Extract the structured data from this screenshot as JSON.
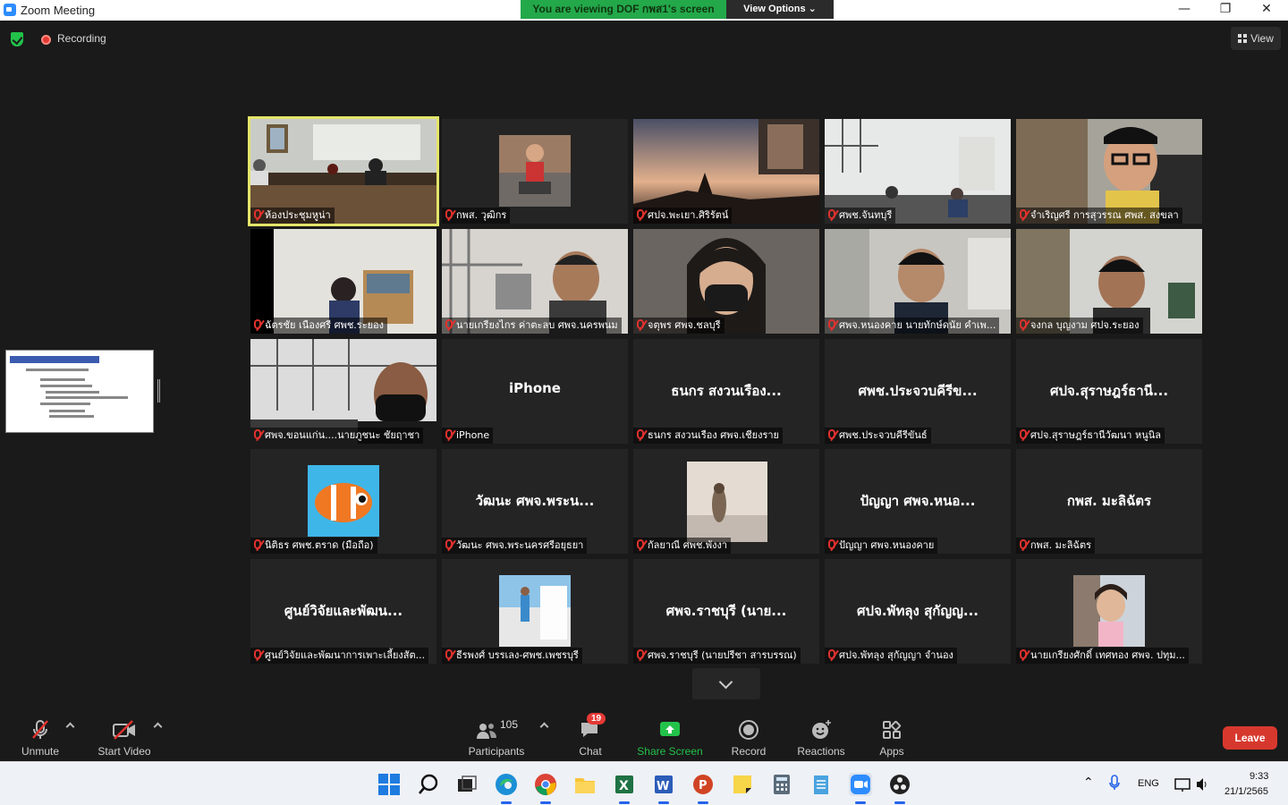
{
  "window": {
    "title": "Zoom Meeting",
    "minimize": "—",
    "restore": "❐",
    "close": "✕"
  },
  "share_banner": {
    "text": "You are viewing DOF กพส1's screen",
    "view_options": "View Options ⌄"
  },
  "topbar": {
    "recording_label": "Recording",
    "view_label": "View"
  },
  "tiles": [
    {
      "name": "ห้องประชุมหูน่า",
      "kind": "video",
      "active": true,
      "scene": "conference"
    },
    {
      "name": "กพส. วุฒิกร",
      "kind": "avatar",
      "scene": "person-red"
    },
    {
      "name": "ศปจ.พะเยา.ศิริรัตน์",
      "kind": "video",
      "scene": "sunset"
    },
    {
      "name": "ศพช.จันทบุรี",
      "kind": "video",
      "scene": "office"
    },
    {
      "name": "จำเริญศรี การสุวรรณ ศพส. สงขลา",
      "kind": "video",
      "scene": "man-glasses"
    },
    {
      "name": "ฉัตรชัย เนืองศรี ศพช.ระยอง",
      "kind": "video",
      "scene": "shelf"
    },
    {
      "name": "นายเกรียงไกร ค่าตะลบ ศพจ.นครพนม",
      "kind": "video",
      "scene": "pipes"
    },
    {
      "name": "จตุพร ศพจ.ชลบุรี",
      "kind": "video",
      "scene": "woman-mask"
    },
    {
      "name": "ศพจ.หนองคาย นายทักษ์ดนัย คำเพ...",
      "kind": "video",
      "scene": "man-office"
    },
    {
      "name": "จงกล บุญงาม ศปจ.ระยอง",
      "kind": "video",
      "scene": "man-office2"
    },
    {
      "name": "ศพจ.ขอนแก่น....นายภูชนะ ชัยฤาชา",
      "kind": "video",
      "scene": "man-mask"
    },
    {
      "name": "iPhone",
      "kind": "text",
      "big": "iPhone"
    },
    {
      "name": "ธนกร สงวนเรือง ศพจ.เชียงราย",
      "kind": "text",
      "big": "ธนกร สงวนเรือง..."
    },
    {
      "name": "ศพช.ประจวบคีรีขันธ์",
      "kind": "text",
      "big": "ศพช.ประจวบคีรีข..."
    },
    {
      "name": "ศปจ.สุราษฎร์ธานีวัฒนา หนูนิล",
      "kind": "text",
      "big": "ศปจ.สุราษฎร์ธานี..."
    },
    {
      "name": "นิติธร ศพช.ตราด (มือถือ)",
      "kind": "avatar",
      "scene": "fish"
    },
    {
      "name": "วัฒนะ ศพจ.พระนครศรีอยุธยา",
      "kind": "text",
      "big": "วัฒนะ ศพจ.พระน..."
    },
    {
      "name": "กัลยาณี ศพช.พังงา",
      "kind": "avatar",
      "scene": "beach"
    },
    {
      "name": "ปัญญา ศพจ.หนองคาย",
      "kind": "text",
      "big": "ปัญญา ศพจ.หนอ..."
    },
    {
      "name": "กพส. มะลิฉัตร",
      "kind": "text",
      "big": "กพส. มะลิฉัตร"
    },
    {
      "name": "ศูนย์วิจัยและพัฒนาการเพาะเลี้ยงสัต...",
      "kind": "text",
      "big": "ศูนย์วิจัยและพัฒน..."
    },
    {
      "name": "ธีรพงศ์ บรรเลง-ศพช.เพชรบุรี",
      "kind": "avatar",
      "scene": "pool"
    },
    {
      "name": "ศพจ.ราชบุรี (นายปรีชา สารบรรณ)",
      "kind": "text",
      "big": "ศพจ.ราชบุรี (นาย..."
    },
    {
      "name": "ศปจ.พัทลุง สุกัญญา จำนอง",
      "kind": "text",
      "big": "ศปจ.พัทลุง สุกัญญ..."
    },
    {
      "name": "นายเกรียงศักดิ์ เทศทอง ศพจ. ปทุม...",
      "kind": "avatar",
      "scene": "girl"
    }
  ],
  "toolbar": {
    "unmute": "Unmute",
    "start_video": "Start Video",
    "participants_count": "105",
    "participants": "Participants",
    "chat": "Chat",
    "chat_badge": "19",
    "share_screen": "Share Screen",
    "record": "Record",
    "reactions": "Reactions",
    "apps": "Apps",
    "leave": "Leave"
  },
  "tray": {
    "lang": "ENG",
    "time": "9:33",
    "date": "21/1/2565"
  },
  "colors": {
    "accent": "#2d8cff",
    "share_green": "#23c24a",
    "leave_red": "#d7382e",
    "active_border": "#e4e46a"
  }
}
